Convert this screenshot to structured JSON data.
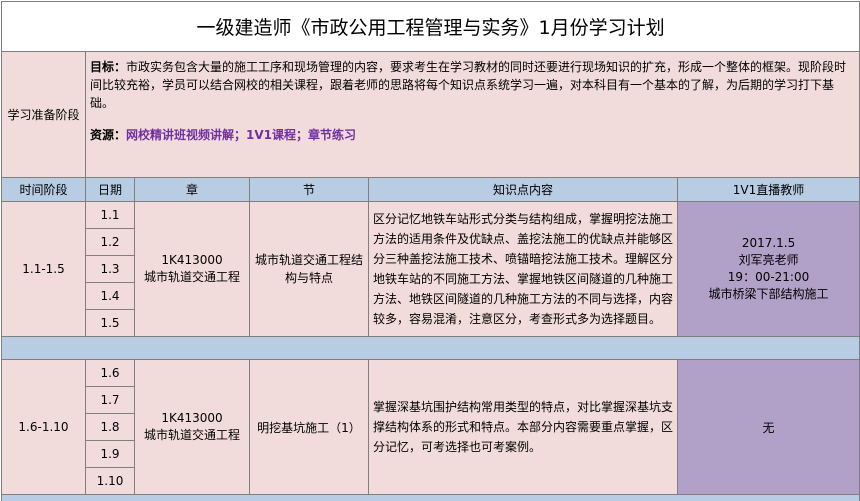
{
  "title": "一级建造师《市政公用工程管理与实务》1月份学习计划",
  "prep": {
    "label": "学习准备阶段",
    "goal_label": "目标：",
    "goal_text": "市政实务包含大量的施工工序和现场管理的内容，要求考生在学习教材的同时还要进行现场知识的扩充，形成一个整体的框架。现阶段时间比较充裕，学员可以结合网校的相关课程，跟着老师的思路将每个知识点系统学习一遍，对本科目有一个基本的了解，为后期的学习打下基础。",
    "resource_label": "资源：",
    "resource_text": "网校精讲班视频讲解；1V1课程；章节练习"
  },
  "headers": [
    "时间阶段",
    "日期",
    "章",
    "节",
    "知识点内容",
    "1V1直播教师"
  ],
  "stages": [
    {
      "period": "1.1-1.5",
      "dates": [
        "1.1",
        "1.2",
        "1.3",
        "1.4",
        "1.5"
      ],
      "chapter_code": "1K413000",
      "chapter_name": "城市轨道交通工程",
      "section": "城市轨道交通工程结构与特点",
      "knowledge": "区分记忆地铁车站形式分类与结构组成，掌握明挖法施工方法的适用条件及优缺点、盖挖法施工的优缺点并能够区分三种盖挖法施工技术、喷锚暗挖法施工技术。理解区分地铁车站的不同施工方法、掌握地铁区间隧道的几种施工方法、地铁区间隧道的几种施工方法的不同与选择，内容较多，容易混淆，注意区分，考查形式多为选择题目。",
      "teacher": {
        "date": "2017.1.5",
        "name": "刘军亮老师",
        "time": "19：00-21:00",
        "topic": "城市桥梁下部结构施工"
      }
    },
    {
      "period": "1.6-1.10",
      "dates": [
        "1.6",
        "1.7",
        "1.8",
        "1.9",
        "1.10"
      ],
      "chapter_code": "1K413000",
      "chapter_name": "城市轨道交通工程",
      "section": "明挖基坑施工（1）",
      "knowledge": "掌握深基坑围护结构常用类型的特点，对比掌握深基坑支撑结构体系的形式和特点。本部分内容需要重点掌握，区分记忆，可考选择也可考案例。",
      "teacher": {
        "none": "无"
      }
    }
  ]
}
